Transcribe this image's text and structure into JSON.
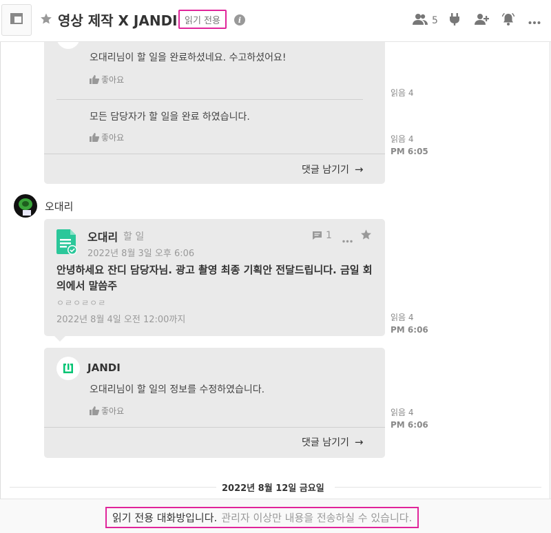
{
  "header": {
    "title": "영상 제작 X JANDI",
    "readonly_badge": "읽기 전용",
    "member_count": "5",
    "icons": [
      "panel-icon",
      "star-icon",
      "info-icon",
      "members-icon",
      "plug-icon",
      "add-member-icon",
      "bell-icon",
      "more-icon"
    ]
  },
  "messages": {
    "top_card": {
      "text1": "오대리님이 할 일을 완료하셨네요. 수고하셨어요!",
      "like1": "좋아요",
      "read1": "읽음 4",
      "text2": "모든 담당자가 할 일을 완료 하였습니다.",
      "like2": "좋아요",
      "read2": "읽음 4",
      "time2": "PM 6:05",
      "comment": "댓글 남기기"
    },
    "post": {
      "author": "오대리",
      "task_card": {
        "author": "오대리",
        "type": "할 일",
        "created": "2022년 8월 3일 오후 6:06",
        "comment_count": "1",
        "title": "안녕하세요 잔디 담당자님. 광고 촬영 최종 기획안 전달드립니다. 금일 회의에서 말씀주",
        "body": "ㅇㄹㅇㄹㅇㄹ",
        "due": "2022년 8월 4일 오전 12:00까지",
        "read": "읽음 4",
        "time": "PM 6:06"
      },
      "jandi_card": {
        "sender": "JANDI",
        "text": "오대리님이 할 일의 정보를 수정하였습니다.",
        "like": "좋아요",
        "read": "읽음 4",
        "time": "PM 6:06",
        "comment": "댓글 남기기"
      }
    }
  },
  "date_separator": "2022년 8월 12일 금요일",
  "footer": {
    "strong": "읽기 전용 대화방입니다.",
    "muted": "관리자 이상만 내용을 전송하실 수 있습니다."
  },
  "colors": {
    "highlight": "#e0249a",
    "jandi_green": "#00c473",
    "card_bg": "#eaeaea"
  }
}
